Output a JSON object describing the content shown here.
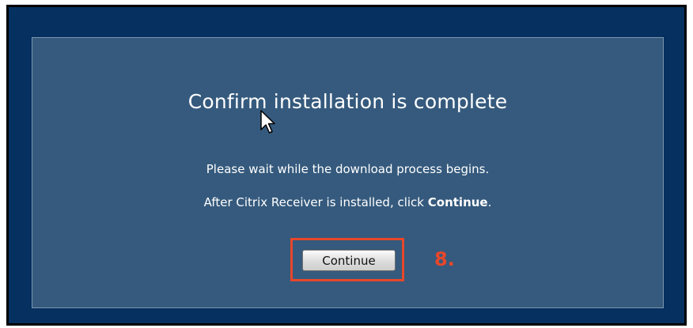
{
  "dialog": {
    "title": "Confirm installation is complete",
    "message_line1": "Please wait while the download process begins.",
    "message_line2_prefix": "After Citrix Receiver is installed, click ",
    "message_line2_bold": "Continue",
    "message_line2_suffix": ".",
    "continue_button_label": "Continue"
  },
  "annotation": {
    "step_label": "8.",
    "highlight_color": "#e8462a"
  },
  "colors": {
    "background": "#06305f",
    "panel": "#355a7d"
  },
  "icons": {
    "cursor": "mouse-pointer-icon"
  }
}
